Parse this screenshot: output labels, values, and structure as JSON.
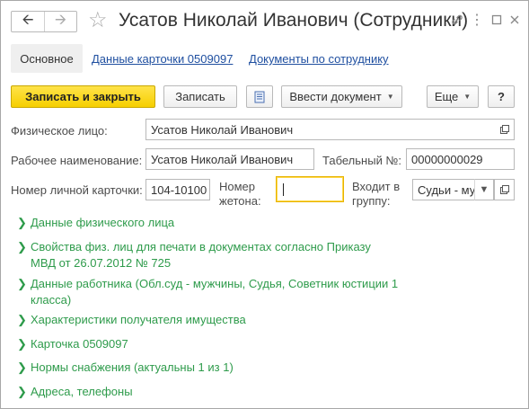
{
  "window": {
    "title": "Усатов Николай Иванович (Сотрудники)",
    "nav_back_icon": "arrow-left-icon",
    "nav_forward_icon": "arrow-right-icon",
    "star_icon": "star-icon",
    "link_icon": "link-icon",
    "menu_icon": "more-vertical-icon",
    "maximize_icon": "maximize-icon",
    "close_icon": "close-icon"
  },
  "tabs": [
    {
      "label": "Основное",
      "active": true
    },
    {
      "label": "Данные карточки 0509097",
      "active": false
    },
    {
      "label": "Документы по сотруднику",
      "active": false
    }
  ],
  "toolbar": {
    "save_close": "Записать и закрыть",
    "save": "Записать",
    "report_icon": "report-icon",
    "enter_document": "Ввести документ",
    "more": "Еще",
    "help": "?"
  },
  "form": {
    "person_label": "Физическое лицо:",
    "person_value": "Усатов Николай Иванович",
    "work_name_label": "Рабочее наименование:",
    "work_name_value": "Усатов Николай Иванович",
    "tab_no_label": "Табельный №:",
    "tab_no_value": "00000000029",
    "card_no_label": "Номер личной карточки:",
    "card_no_value": "104-10100",
    "token_label": "Номер жетона:",
    "token_value": "",
    "group_label": "Входит в группу:",
    "group_value": "Судьи - му"
  },
  "groups": [
    "Данные физического лица",
    "Свойства физ. лиц для печати в документах согласно Приказу МВД от 26.07.2012 № 725",
    "Данные работника (Обл.суд - мужчины, Судья, Советник юстиции 1 класса)",
    "Характеристики получателя имущества",
    "Карточка 0509097",
    "Нормы снабжения (актуальны 1 из 1)",
    "Адреса, телефоны"
  ],
  "colors": {
    "accent_yellow": "#f6cf00",
    "group_green": "#2e9b4b",
    "link_blue": "#1f4fa0"
  }
}
